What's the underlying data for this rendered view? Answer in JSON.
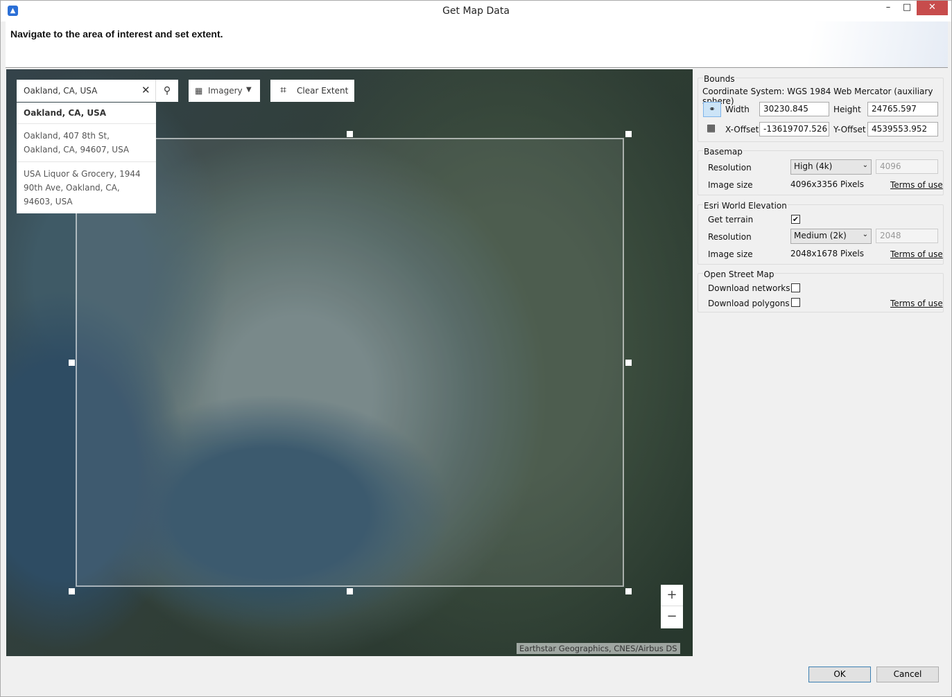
{
  "window": {
    "title": "Get Map Data",
    "minimize": "–",
    "maximize": "□",
    "close": "✕"
  },
  "instruction": "Navigate to the area of interest and set extent.",
  "map": {
    "search": {
      "value": "Oakland, CA, USA",
      "clear": "✕",
      "search_icon": "🔍"
    },
    "suggestions": [
      "Oakland, CA, USA",
      "Oakland, 407 8th St, Oakland, CA, 94607, USA",
      "USA Liquor & Grocery, 1944 90th Ave, Oakland, CA, 94603, USA"
    ],
    "basemap_button": "Imagery",
    "basemap_icon": "basemap-gallery-icon",
    "clear_extent": "Clear Extent",
    "crop_icon": "crop-icon",
    "zoom_in": "+",
    "zoom_out": "−",
    "attribution": "Earthstar Geographics, CNES/Airbus DS"
  },
  "bounds": {
    "legend": "Bounds",
    "coordinate_system": "Coordinate System: WGS 1984 Web Mercator (auxiliary sphere)",
    "width_label": "Width",
    "width": "30230.845",
    "height_label": "Height",
    "height": "24765.597",
    "xoffset_label": "X-Offset",
    "xoffset": "-13619707.526",
    "yoffset_label": "Y-Offset",
    "yoffset": "4539553.952"
  },
  "basemap": {
    "legend": "Basemap",
    "resolution_label": "Resolution",
    "resolution": "High (4k)",
    "resolution_value": "4096",
    "image_size_label": "Image size",
    "image_size": "4096x3356 Pixels",
    "terms": "Terms of use"
  },
  "elevation": {
    "legend": "Esri World Elevation",
    "terrain_label": "Get terrain",
    "terrain_checked": true,
    "check": "✔",
    "resolution_label": "Resolution",
    "resolution": "Medium (2k)",
    "resolution_value": "2048",
    "image_size_label": "Image size",
    "image_size": "2048x1678 Pixels",
    "terms": "Terms of use"
  },
  "osm": {
    "legend": "Open Street Map",
    "networks_label": "Download networks",
    "networks_checked": false,
    "polygons_label": "Download polygons",
    "polygons_checked": false,
    "terms": "Terms of use"
  },
  "footer": {
    "ok": "OK",
    "cancel": "Cancel"
  }
}
